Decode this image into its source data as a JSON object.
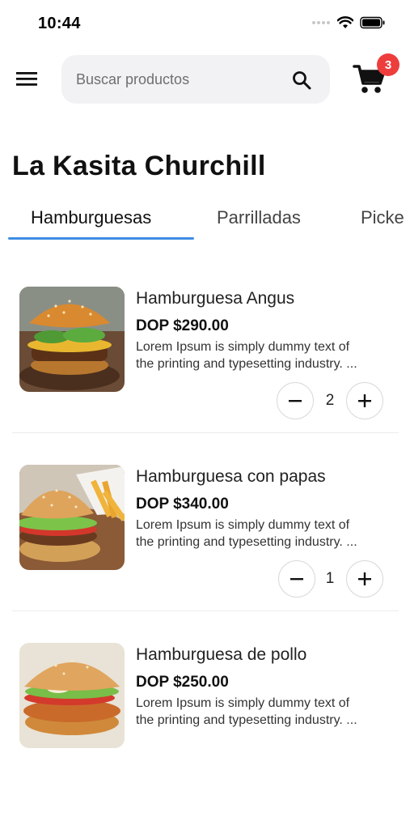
{
  "status": {
    "time": "10:44"
  },
  "search": {
    "placeholder": "Buscar productos"
  },
  "cart": {
    "badge_count": "3",
    "badge_color": "#ee3d3d"
  },
  "store": {
    "title": "La Kasita Churchill"
  },
  "tabs": [
    {
      "label": "Hamburguesas",
      "active": true
    },
    {
      "label": "Parrilladas",
      "active": false
    },
    {
      "label": "Picke",
      "active": false
    }
  ],
  "accent_color": "#3f8de4",
  "products": [
    {
      "name": "Hamburguesa Angus",
      "price": "DOP $290.00",
      "desc_line1": "Lorem Ipsum is simply dummy text of",
      "desc_line2": "the printing and typesetting industry. ...",
      "quantity": "2"
    },
    {
      "name": "Hamburguesa con papas",
      "price": "DOP $340.00",
      "desc_line1": "Lorem Ipsum is simply dummy text of",
      "desc_line2": "the printing and typesetting industry. ...",
      "quantity": "1"
    },
    {
      "name": "Hamburguesa de pollo",
      "price": "DOP $250.00",
      "desc_line1": "Lorem Ipsum is simply dummy text of",
      "desc_line2": "the printing and typesetting industry. ..."
    }
  ],
  "icons": {
    "menu": "hamburger-menu-icon",
    "search": "search-icon",
    "cart": "shopping-cart-icon",
    "decrement": "minus-icon",
    "increment": "plus-icon"
  }
}
